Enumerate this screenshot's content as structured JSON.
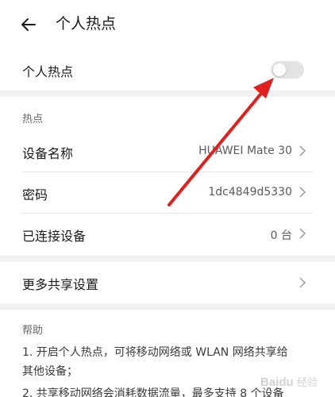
{
  "header": {
    "title": "个人热点"
  },
  "hotspot_toggle": {
    "label": "个人热点",
    "enabled": false
  },
  "hotspot_section": {
    "title": "热点",
    "items": [
      {
        "label": "设备名称",
        "value": "HUAWEI Mate 30"
      },
      {
        "label": "密码",
        "value": "1dc4849d5330"
      },
      {
        "label": "已连接设备",
        "value": "0 台"
      }
    ]
  },
  "more_settings": {
    "label": "更多共享设置"
  },
  "help": {
    "title": "帮助",
    "lines": [
      "1. 开启个人热点，可将移动网络或 WLAN 网络共享给",
      "其他设备；",
      "2. 共享移动网络会消耗数据流量，最多支持 8 个设备"
    ]
  },
  "annotation": {
    "arrow_color": "#e0201c"
  },
  "watermark": {
    "text": "Baidu 经验"
  }
}
